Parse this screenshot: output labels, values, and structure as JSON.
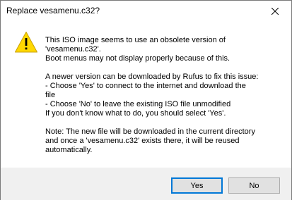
{
  "window": {
    "title": "Replace vesamenu.c32?"
  },
  "titlebar": {
    "close_icon": "close-icon"
  },
  "dialog": {
    "icon": "warning-icon",
    "icon_color": "#ffd800",
    "lines": [
      "This ISO image seems to use an obsolete version of",
      "'vesamenu.c32'.",
      "Boot menus may not display properly because of this.",
      "",
      "A newer version can be downloaded by Rufus to fix this issue:",
      "- Choose 'Yes' to connect to the internet and download the",
      "file",
      "- Choose 'No' to leave the existing ISO file unmodified",
      "If you don't know what to do, you should select 'Yes'.",
      "",
      "Note: The new file will be downloaded in the current directory",
      "and once a 'vesamenu.c32' exists there, it will be reused",
      "automatically."
    ]
  },
  "buttons": {
    "yes_label": "Yes",
    "no_label": "No",
    "default_border_color": "#0078d7"
  }
}
